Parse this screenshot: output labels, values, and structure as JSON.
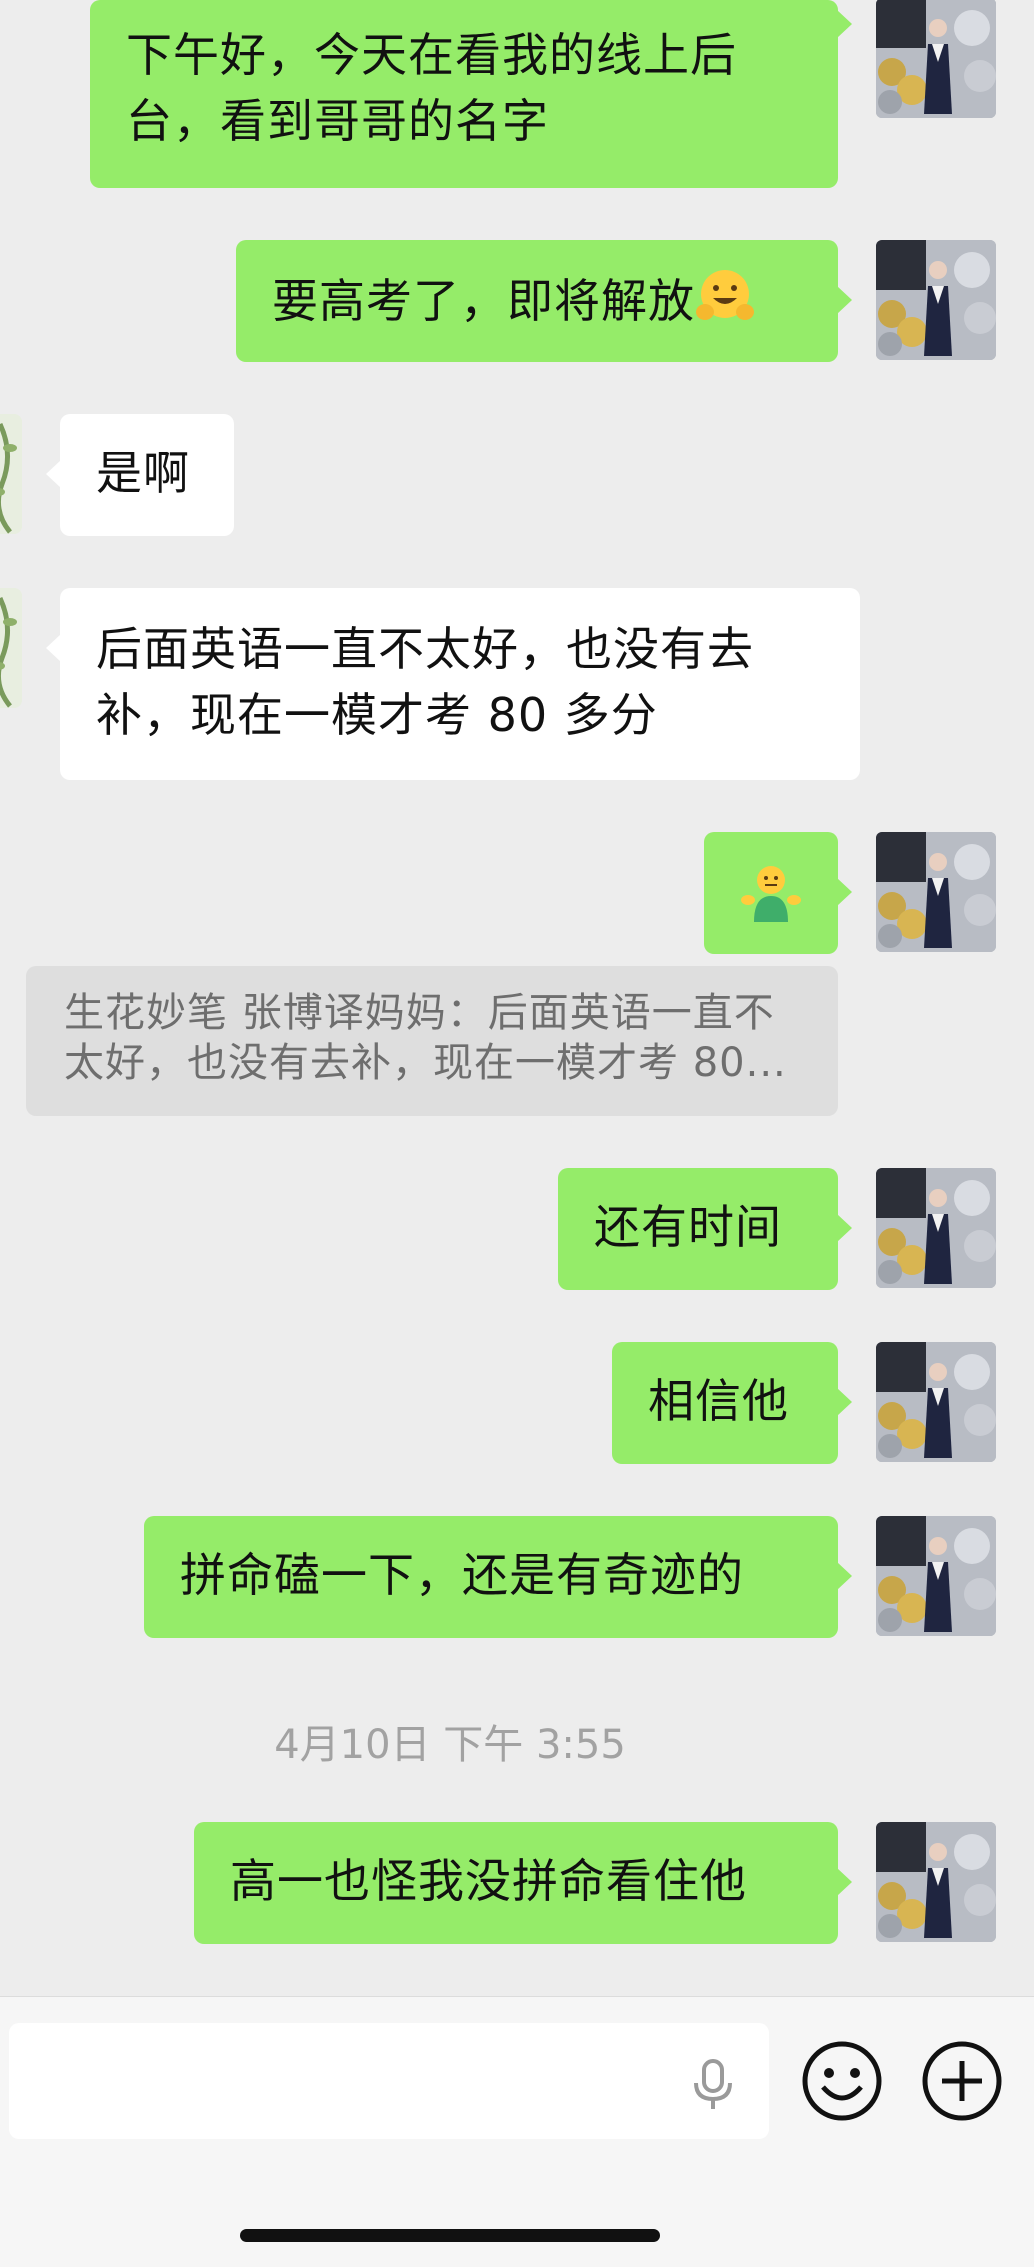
{
  "messages": [
    {
      "side": "me",
      "line1": "下午好，今天在看我的线上后",
      "line2": "台，看到哥哥的名字"
    },
    {
      "side": "me",
      "text": "要高考了，即将解放",
      "emoji": "hugging-face"
    },
    {
      "side": "other",
      "text": "是啊"
    },
    {
      "side": "other",
      "line1": "后面英语一直不太好，也没有去",
      "line2": "补，现在一模才考 80 多分"
    },
    {
      "side": "me",
      "emoji": "shrugging-person"
    },
    {
      "side": "me",
      "text": "还有时间"
    },
    {
      "side": "me",
      "text": "相信他"
    },
    {
      "side": "me",
      "text": "拼命磕一下，还是有奇迹的"
    },
    {
      "side": "me",
      "text": "高一也怪我没拼命看住他"
    }
  ],
  "quote": {
    "line1": "生花妙笔 张博译妈妈：后面英语一直不",
    "line2": "太好，也没有去补，现在一模才考 80..."
  },
  "timestamp": "4月10日 下午 3:55",
  "input": {
    "placeholder": "",
    "value": ""
  },
  "colors": {
    "background": "#ededed",
    "my_bubble": "#95ec69",
    "other_bubble": "#ffffff",
    "quote_bg": "#dedede",
    "timestamp_text": "#a2a2a2"
  },
  "icons": [
    "voice-input-icon",
    "emoji-icon",
    "more-plus-icon"
  ]
}
